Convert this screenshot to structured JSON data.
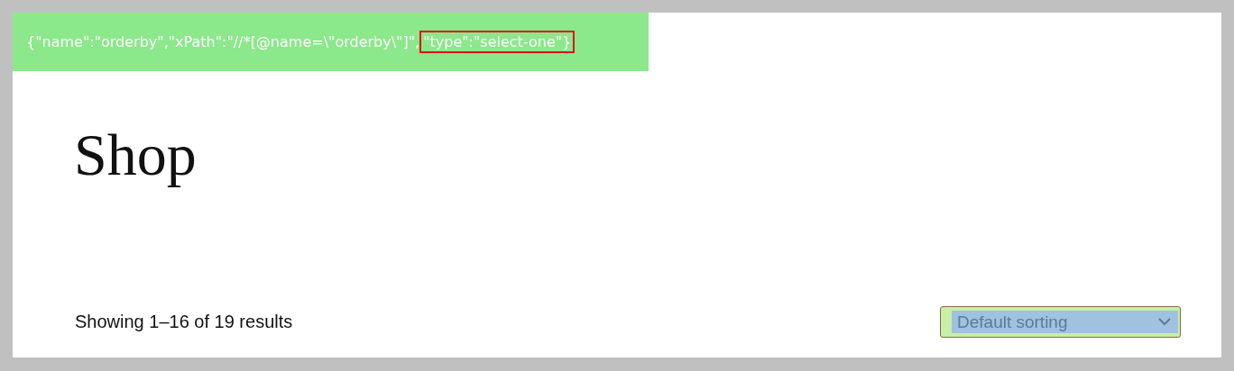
{
  "banner": {
    "text": "{\"name\":\"orderby\",\"xPath\":\"//*[@name=\\\"orderby\\\"]\",",
    "highlighted": "\"type\":\"select-one\"}"
  },
  "title": "Shop",
  "result_count": "Showing 1–16 of 19 results",
  "sort_select": {
    "value": "Default sorting"
  }
}
